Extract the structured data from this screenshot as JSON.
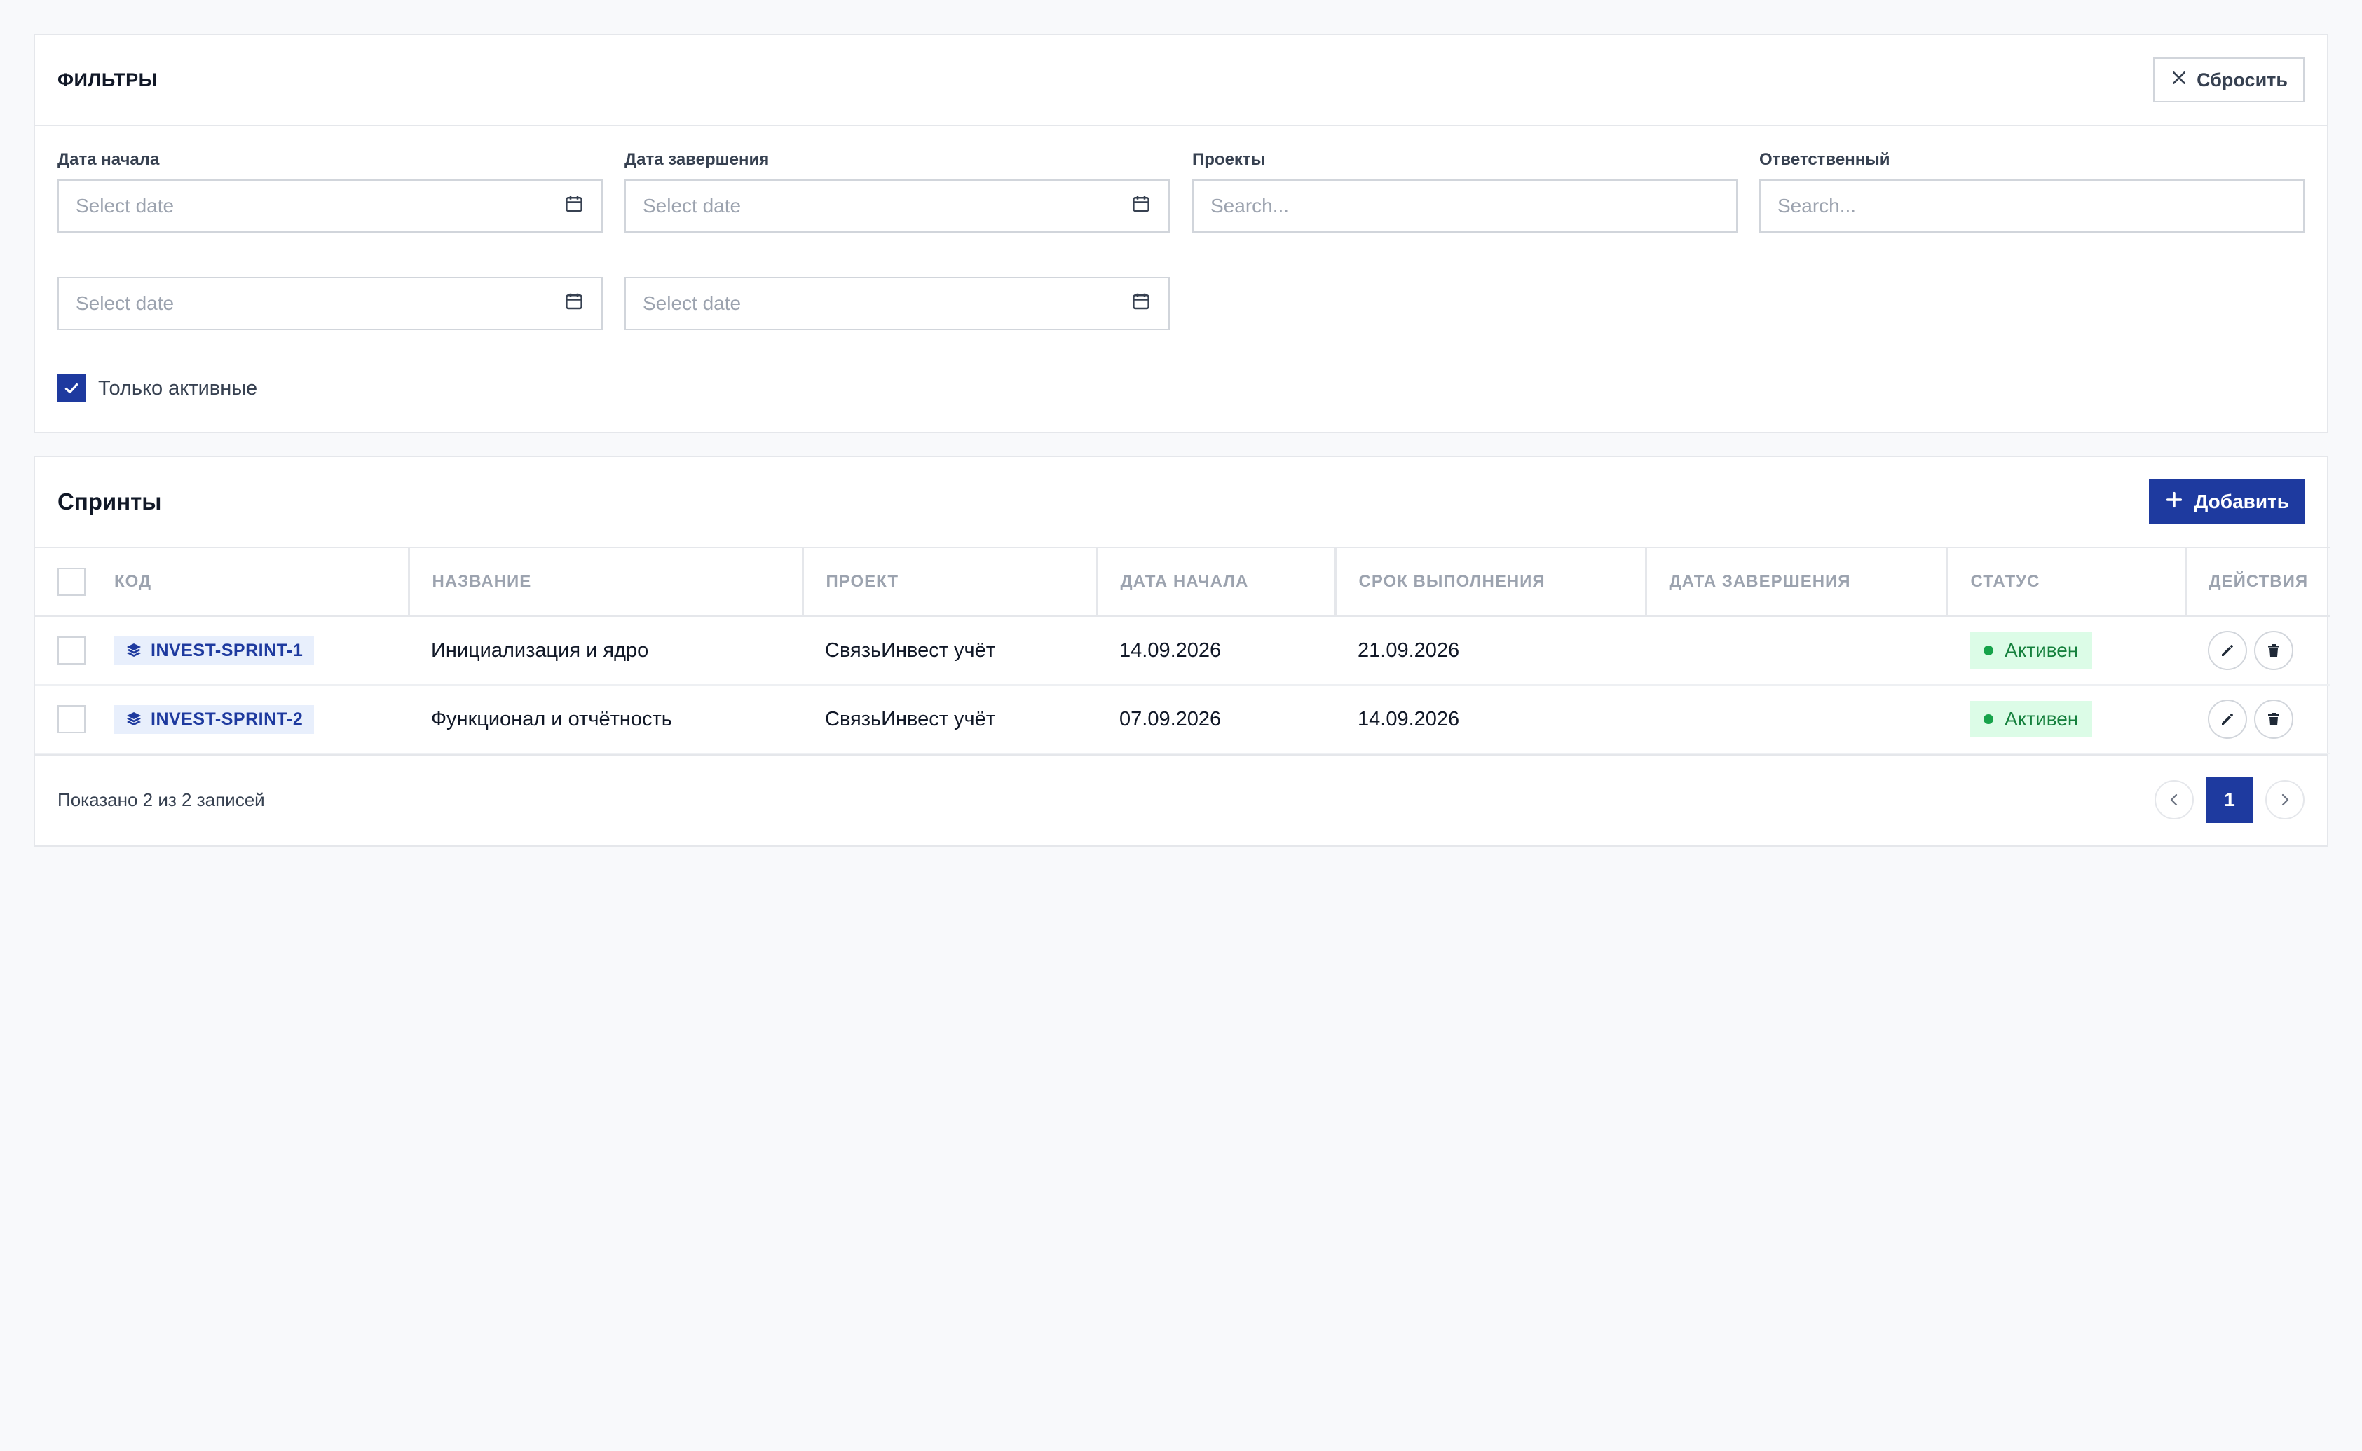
{
  "filters": {
    "title": "ФИЛЬТРЫ",
    "reset_label": "Сбросить",
    "start_date_label": "Дата начала",
    "end_date_label": "Дата завершения",
    "projects_label": "Проекты",
    "assignee_label": "Ответственный",
    "date_placeholder": "Select date",
    "search_placeholder": "Search...",
    "active_only_label": "Только активные",
    "active_only_checked": true
  },
  "sprints": {
    "title": "Спринты",
    "add_label": "Добавить",
    "columns": [
      "КОД",
      "НАЗВАНИЕ",
      "ПРОЕКТ",
      "ДАТА НАЧАЛА",
      "СРОК ВЫПОЛНЕНИЯ",
      "ДАТА ЗАВЕРШЕНИЯ",
      "СТАТУС",
      "ДЕЙСТВИЯ"
    ],
    "rows": [
      {
        "code": "INVEST-SPRINT-1",
        "name": "Инициализация и ядро",
        "project": "СвязьИнвест учёт",
        "start": "14.09.2026",
        "due": "21.09.2026",
        "finished": "",
        "status": "Активен"
      },
      {
        "code": "INVEST-SPRINT-2",
        "name": "Функционал и отчётность",
        "project": "СвязьИнвест учёт",
        "start": "07.09.2026",
        "due": "14.09.2026",
        "finished": "",
        "status": "Активен"
      }
    ],
    "footer_info": "Показано 2 из 2 записей",
    "current_page": "1"
  },
  "colors": {
    "accent": "#1e3a9f",
    "status_bg": "#dcfce7",
    "status_text": "#15803d"
  },
  "icons": [
    "close-icon",
    "calendar-icon",
    "check-icon",
    "plus-icon",
    "layers-icon",
    "pencil-icon",
    "trash-icon",
    "chevron-left-icon",
    "chevron-right-icon"
  ]
}
